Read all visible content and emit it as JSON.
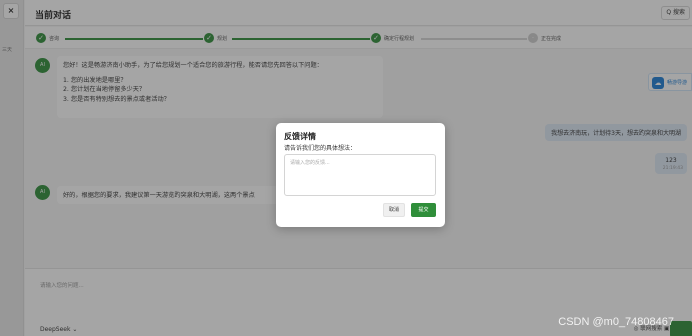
{
  "left_rail": {
    "close_glyph": "×",
    "text": "三天"
  },
  "header": {
    "title": "当前对话",
    "search_label": "Q 搜索"
  },
  "steps": [
    {
      "label": "咨询",
      "status": "done"
    },
    {
      "label": "规划",
      "status": "done"
    },
    {
      "label": "确定行程规划",
      "status": "done"
    },
    {
      "label": "正在完成",
      "status": "pending"
    }
  ],
  "messages": {
    "ai1": {
      "avatar": "AI",
      "intro": "您好！这是畅游济南小助手，为了给您规划一个适合您的旅游行程，能否请您先回答以下问题：",
      "q1": "1. 您的出发地是哪里？",
      "q2": "2. 您计划在当地停留多少天？",
      "q3": "3. 您是否有特别想去的景点或者活动？"
    },
    "user1": {
      "text": "我想去济南玩，计划待3天，想去趵突泉和大明湖"
    },
    "user2": {
      "text": "123",
      "time": "21:19:43"
    },
    "ai2": {
      "avatar": "AI",
      "text": "好的，根据您的要求，我建议第一天游览趵突泉和大明湖，这两个景点"
    }
  },
  "floater": {
    "label": "畅游导游"
  },
  "composer": {
    "placeholder": "请输入您的问题...",
    "model": "DeepSeek ⌄",
    "right_tools": "◎ 联网搜索  ▣ 附件"
  },
  "modal": {
    "title": "反馈详情",
    "subtitle": "请告诉我们您的具体想法：",
    "placeholder": "请输入您的反馈...",
    "cancel_label": "取消",
    "submit_label": "提交"
  },
  "watermark": "CSDN @m0_74808467",
  "colors": {
    "accent": "#2f8e3a",
    "info": "#1e7fd6"
  }
}
